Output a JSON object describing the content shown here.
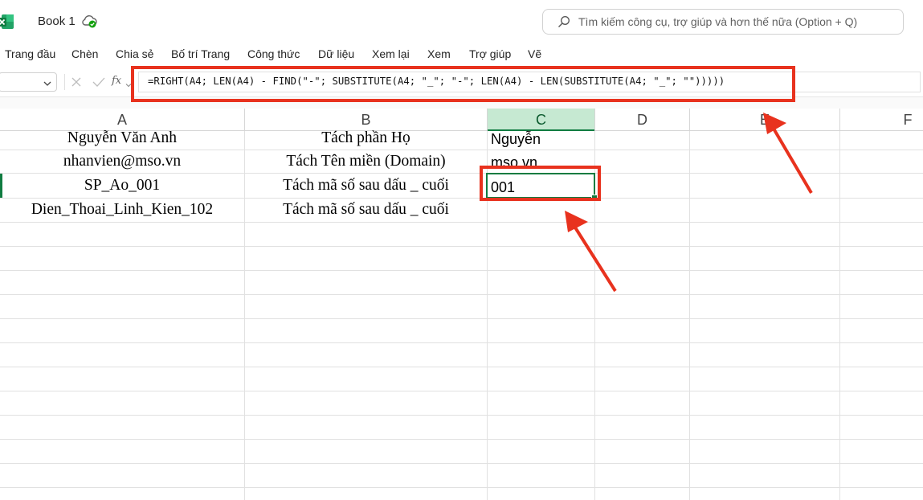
{
  "app": {
    "icon": "excel-icon",
    "title": "Book 1",
    "sync_icon": "cloud-sync-icon"
  },
  "search": {
    "icon": "search-icon",
    "text": "Tìm kiếm công cụ, trợ giúp và hơn thế nữa (Option + Q)"
  },
  "menu": [
    "Trang đầu",
    "Chèn",
    "Chia sẻ",
    "Bố trí Trang",
    "Công thức",
    "Dữ liệu",
    "Xem lại",
    "Xem",
    "Trợ giúp",
    "Vẽ"
  ],
  "formula_bar": {
    "name_box": "",
    "fx_label": "fx",
    "formula": "=RIGHT(A4; LEN(A4) - FIND(\"-\"; SUBSTITUTE(A4; \"_\"; \"-\"; LEN(A4) - LEN(SUBSTITUTE(A4; \"_\"; \"\")))))"
  },
  "columns": [
    "A",
    "B",
    "C",
    "D",
    "E",
    "F"
  ],
  "rows": [
    {
      "a": "Nguyễn Văn Anh",
      "b": "Tách phần Họ",
      "c": "Nguyễn"
    },
    {
      "a": "nhanvien@mso.vn",
      "b": "Tách Tên miền (Domain)",
      "c": "mso.vn"
    },
    {
      "a": "SP_Ao_001",
      "b": "Tách mã số sau dấu _ cuối",
      "c": "001"
    },
    {
      "a": "Dien_Thoai_Linh_Kien_102",
      "b": "Tách mã số sau dấu _ cuối",
      "c": ""
    }
  ],
  "colors": {
    "accent_green": "#107c41",
    "annotation_red": "#e8321e",
    "selected_header": "#c6e9d2"
  }
}
